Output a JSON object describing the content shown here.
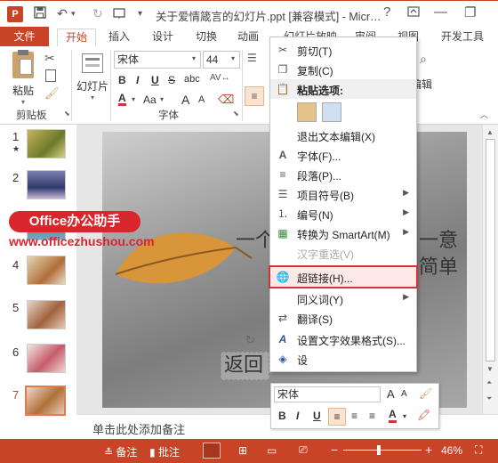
{
  "window": {
    "title": "关于爱情箴言的幻灯片.ppt [兼容模式] - Micr…",
    "help": "?",
    "minimize": "—",
    "restore": "❐"
  },
  "qat": {
    "undo_arrow": "▾",
    "customize": "▾"
  },
  "tabs": [
    {
      "label": "文件"
    },
    {
      "label": "开始"
    },
    {
      "label": "插入"
    },
    {
      "label": "设计"
    },
    {
      "label": "切换"
    },
    {
      "label": "动画"
    },
    {
      "label": "幻灯片放映"
    },
    {
      "label": "审阅"
    },
    {
      "label": "视图"
    },
    {
      "label": "开发工具"
    }
  ],
  "ribbon": {
    "paste_label": "粘贴",
    "new_slide_label": "幻灯片",
    "clipboard_label": "剪贴板",
    "font_group_label": "字体",
    "font_name": "宋体",
    "font_size": "44",
    "bold": "B",
    "italic": "I",
    "underline": "U",
    "strike": "S",
    "abc": "abc",
    "font_color": "A",
    "case": "Aa",
    "grow": "A",
    "shrink": "A",
    "edit_label": "编辑"
  },
  "thumbnails": [
    {
      "num": "1",
      "star": "★"
    },
    {
      "num": "2"
    },
    {
      "num": "3"
    },
    {
      "num": "4"
    },
    {
      "num": "5"
    },
    {
      "num": "6"
    },
    {
      "num": "7"
    }
  ],
  "slide": {
    "text_left_1": "一个",
    "text_right_1": "一意",
    "text_right_2": "简单",
    "back_text": "返回"
  },
  "context_menu": {
    "items": [
      {
        "label": "剪切(T)",
        "icon": "scissors-icon"
      },
      {
        "label": "复制(C)",
        "icon": "copy-icon"
      },
      {
        "label": "粘贴选项:",
        "icon": "paste-icon"
      },
      {
        "label": "退出文本编辑(X)"
      },
      {
        "label": "字体(F)...",
        "icon": "font-icon"
      },
      {
        "label": "段落(P)...",
        "icon": "paragraph-icon"
      },
      {
        "label": "项目符号(B)",
        "icon": "bullets-icon",
        "submenu": true
      },
      {
        "label": "编号(N)",
        "icon": "numbering-icon",
        "submenu": true
      },
      {
        "label": "转换为 SmartArt(M)",
        "icon": "smartart-icon",
        "submenu": true
      },
      {
        "label": "汉字重选(V)",
        "disabled": true
      },
      {
        "label": "超链接(H)...",
        "icon": "hyperlink-icon",
        "highlighted": true
      },
      {
        "label": "同义词(Y)",
        "submenu": true
      },
      {
        "label": "翻译(S)",
        "icon": "translate-icon"
      },
      {
        "label": "设置文字效果格式(S)...",
        "icon": "text-effects-icon"
      },
      {
        "label": "设",
        "icon": "shape-format-icon"
      }
    ]
  },
  "minitoolbar": {
    "font_name": "宋体",
    "bold": "B",
    "italic": "I",
    "underline": "U",
    "color_a": "A"
  },
  "notes": {
    "placeholder": "单击此处添加备注"
  },
  "status": {
    "notes": "备注",
    "comments": "批注",
    "zoom": "46%"
  },
  "watermark": {
    "brand": "Office办公助手",
    "url": "www.officezhushou.com"
  },
  "colors": {
    "accent": "#c94426",
    "highlight_border": "#d13438"
  }
}
